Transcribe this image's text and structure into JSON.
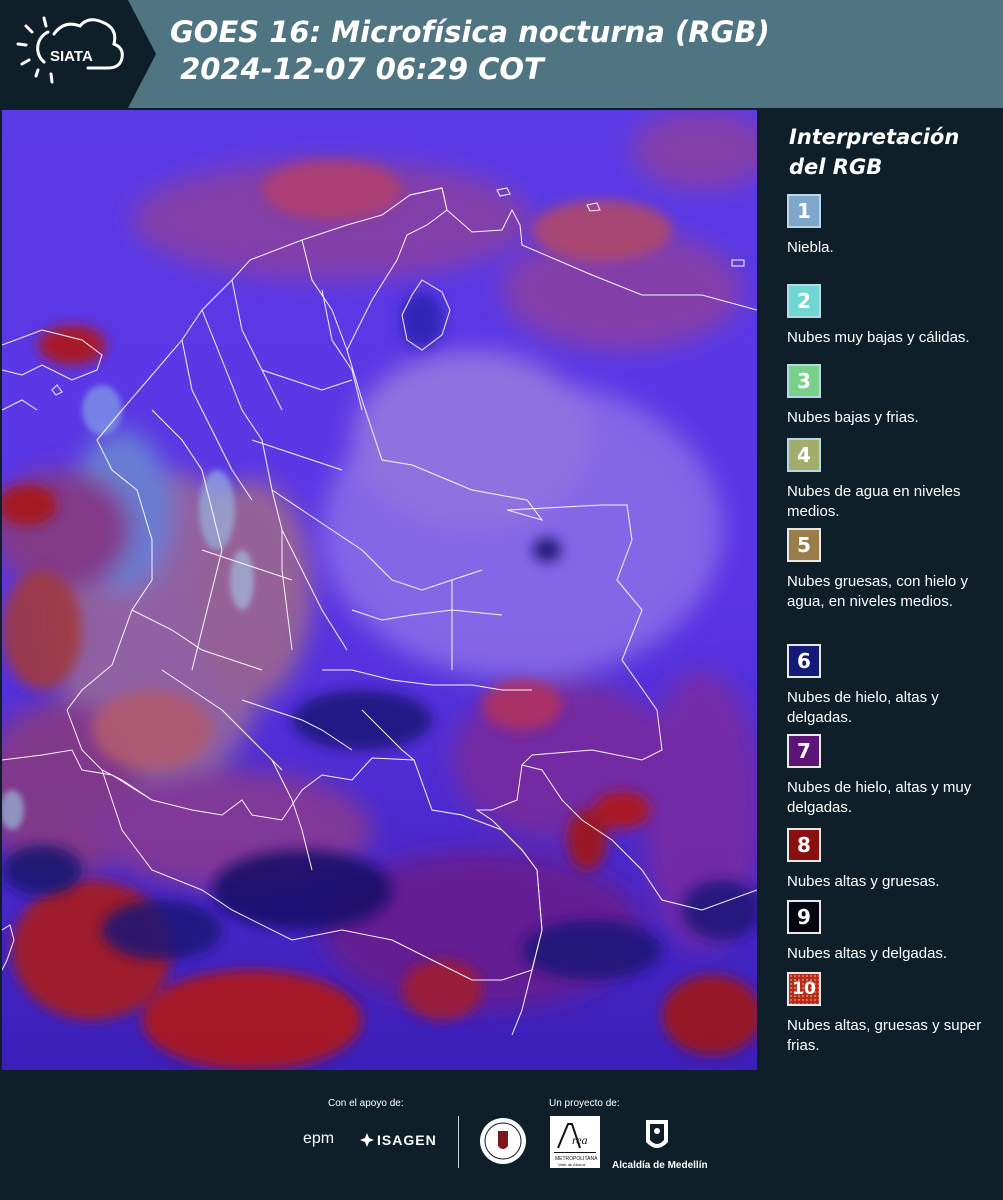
{
  "header": {
    "logo_text": "SIATA",
    "title_line1": "GOES 16: Microfísica nocturna (RGB)",
    "title_line2": " 2024-12-07 06:29 COT"
  },
  "legend": {
    "title": "Interpretación del RGB",
    "items": [
      {
        "number": "1",
        "label": "Niebla.",
        "color": "#7fa7cb"
      },
      {
        "number": "2",
        "label": "Nubes muy bajas y cálidas.",
        "color": "#6fd6d2"
      },
      {
        "number": "3",
        "label": "Nubes bajas y frias.",
        "color": "#78d089"
      },
      {
        "number": "4",
        "label": "Nubes de agua en niveles medios.",
        "color": "#a3ac6a"
      },
      {
        "number": "5",
        "label": "Nubes gruesas, con hielo y agua, en niveles medios.",
        "color": "#9b7d4a"
      },
      {
        "number": "6",
        "label": "Nubes de hielo, altas y delgadas.",
        "color": "#141a78"
      },
      {
        "number": "7",
        "label": "Nubes de hielo, altas y muy delgadas.",
        "color": "#5d1478"
      },
      {
        "number": "8",
        "label": "Nubes altas y gruesas.",
        "color": "#8a1010"
      },
      {
        "number": "9",
        "label": "Nubes altas y delgadas.",
        "color": "#050510"
      },
      {
        "number": "10",
        "label": "Nubes altas, gruesas y super frias.",
        "color": "#b02a1a"
      }
    ]
  },
  "footer": {
    "support_label": "Con el apoyo de:",
    "project_label": "Un proyecto de:",
    "sponsors": [
      "epm",
      "ISAGEN"
    ],
    "partners": [
      "Área Metropolitana Valle de Aburrá",
      "Alcaldía de Medellín"
    ],
    "alcaldia_text": "Alcaldía de Medellín"
  },
  "colors": {
    "header_bg": "#4f7482",
    "panel_bg": "#0e1f2a",
    "map_base": "#5a35e0"
  }
}
